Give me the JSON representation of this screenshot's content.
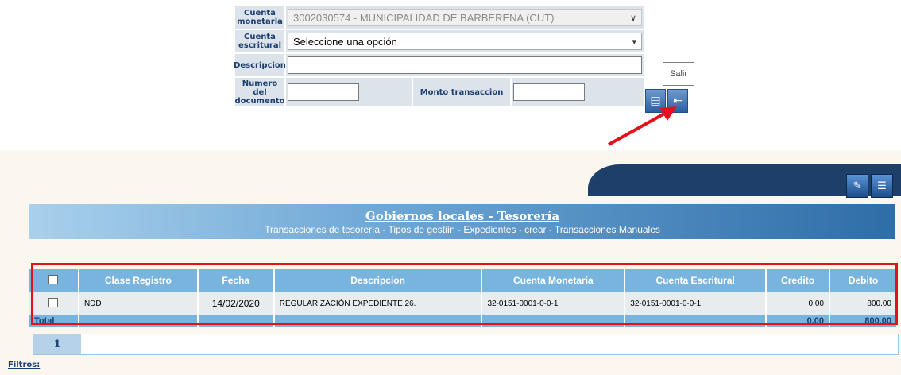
{
  "form": {
    "cuenta_monetaria_label": "Cuenta monetaria",
    "cuenta_monetaria_value": "3002030574 - MUNICIPALIDAD DE BARBERENA (CUT)",
    "cuenta_escritural_label": "Cuenta escritural",
    "cuenta_escritural_value": "Seleccione una opción",
    "descripcion_label": "Descripcion",
    "numero_documento_label": "Numero del documento",
    "monto_label": "Monto transaccion"
  },
  "tooltip": "Salir",
  "icons": [
    "save-icon",
    "exit-icon",
    "eraser-icon",
    "database-icon"
  ],
  "page": {
    "title": "Gobiernos locales - Tesorería",
    "subtitle": "Transacciones de tesorería - Tipos de gestiín - Expedientes - crear - Transacciones Manuales"
  },
  "table": {
    "headers": [
      "Clase Registro",
      "Fecha",
      "Descripcion",
      "Cuenta Monetaria",
      "Cuenta Escritural",
      "Credito",
      "Debito"
    ],
    "rows": [
      {
        "clase": "NDD",
        "fecha": "14/02/2020",
        "descripcion": "REGULARIZACIÓN EXPEDIENTE 26.",
        "cuenta_monetaria": "32-0151-0001-0-0-1",
        "cuenta_escritural": "32-0151-0001-0-0-1",
        "credito": "0.00",
        "debito": "800.00"
      }
    ],
    "total_label": "Total",
    "total_credito": "0.00",
    "total_debito": "800.00"
  },
  "pager": {
    "page": "1"
  },
  "filtros_label": "Filtros:",
  "colors": {
    "highlight": "#e4111a",
    "header": "#79b4df",
    "brand": "#1d3f69"
  }
}
